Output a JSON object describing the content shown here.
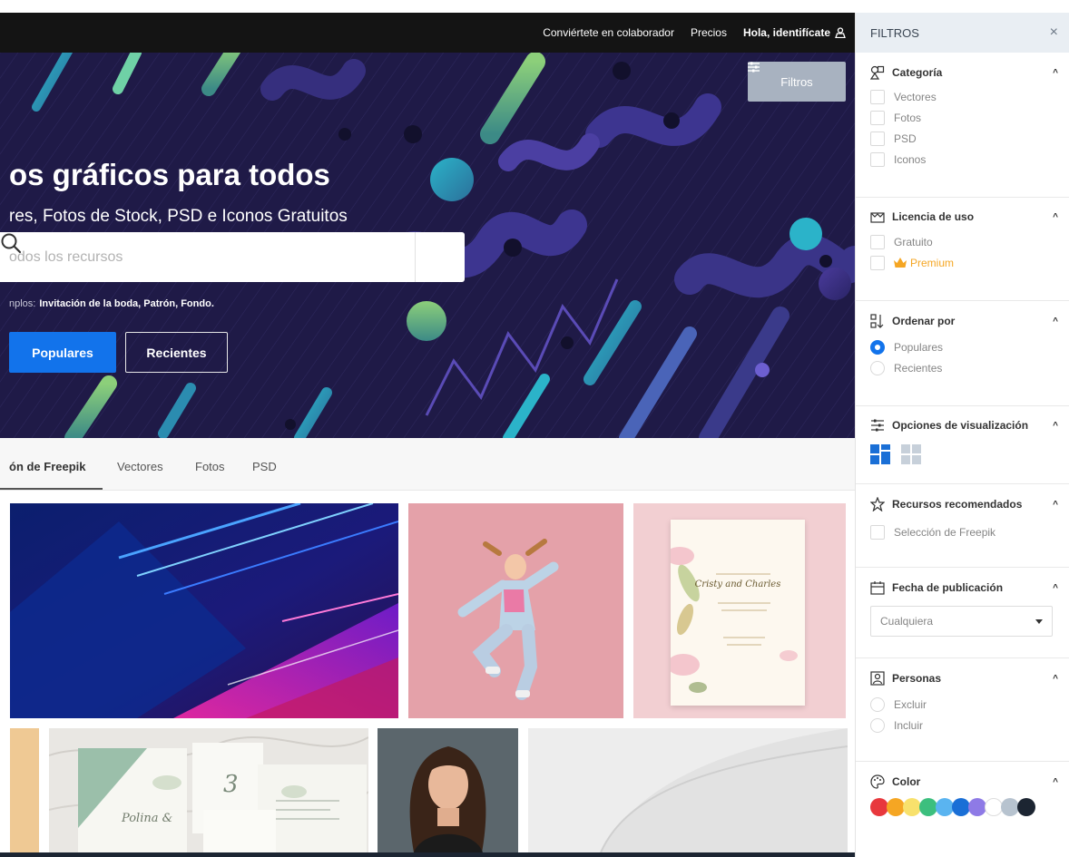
{
  "topbar": {
    "contributor": "Conviértete en colaborador",
    "pricing": "Precios",
    "login": "Hola, identifícate"
  },
  "hero": {
    "title": "os gráficos para todos",
    "subtitle": "res, Fotos de Stock, PSD e Iconos Gratuitos",
    "search_placeholder": "odos los recursos",
    "examples_label": "nplos:",
    "examples_links": "Invitación de la boda, Patrón, Fondo.",
    "btn_popular": "Populares",
    "btn_recent": "Recientes",
    "btn_filters": "Filtros"
  },
  "tabs": {
    "items": [
      "ón de Freepik",
      "Vectores",
      "Fotos",
      "PSD"
    ],
    "active": 0
  },
  "gallery": {
    "invitation_names": "Cristy and Charles",
    "invitation2_text": "Polina &"
  },
  "sidebar": {
    "title": "FILTROS",
    "close": "×",
    "category": {
      "title": "Categoría",
      "options": [
        "Vectores",
        "Fotos",
        "PSD",
        "Iconos"
      ]
    },
    "license": {
      "title": "Licencia de uso",
      "options": [
        "Gratuito",
        "Premium"
      ]
    },
    "sort": {
      "title": "Ordenar por",
      "options": [
        "Populares",
        "Recientes"
      ],
      "selected": 0
    },
    "display": {
      "title": "Opciones de visualización"
    },
    "recommended": {
      "title": "Recursos recomendados",
      "options": [
        "Selección de Freepik"
      ]
    },
    "date": {
      "title": "Fecha de publicación",
      "value": "Cualquiera"
    },
    "people": {
      "title": "Personas",
      "options": [
        "Excluir",
        "Incluir"
      ]
    },
    "color": {
      "title": "Color",
      "swatches": [
        "#e8383d",
        "#f5a623",
        "#f8e16c",
        "#3cbf7e",
        "#5ab4f0",
        "#1a6fd6",
        "#8e7ae6",
        "#ffffff",
        "#b7c3cf",
        "#1c2532"
      ]
    }
  },
  "colors": {
    "accent": "#1273eb",
    "hero_bg": "#1f1a47",
    "topbar_bg": "#141414"
  }
}
